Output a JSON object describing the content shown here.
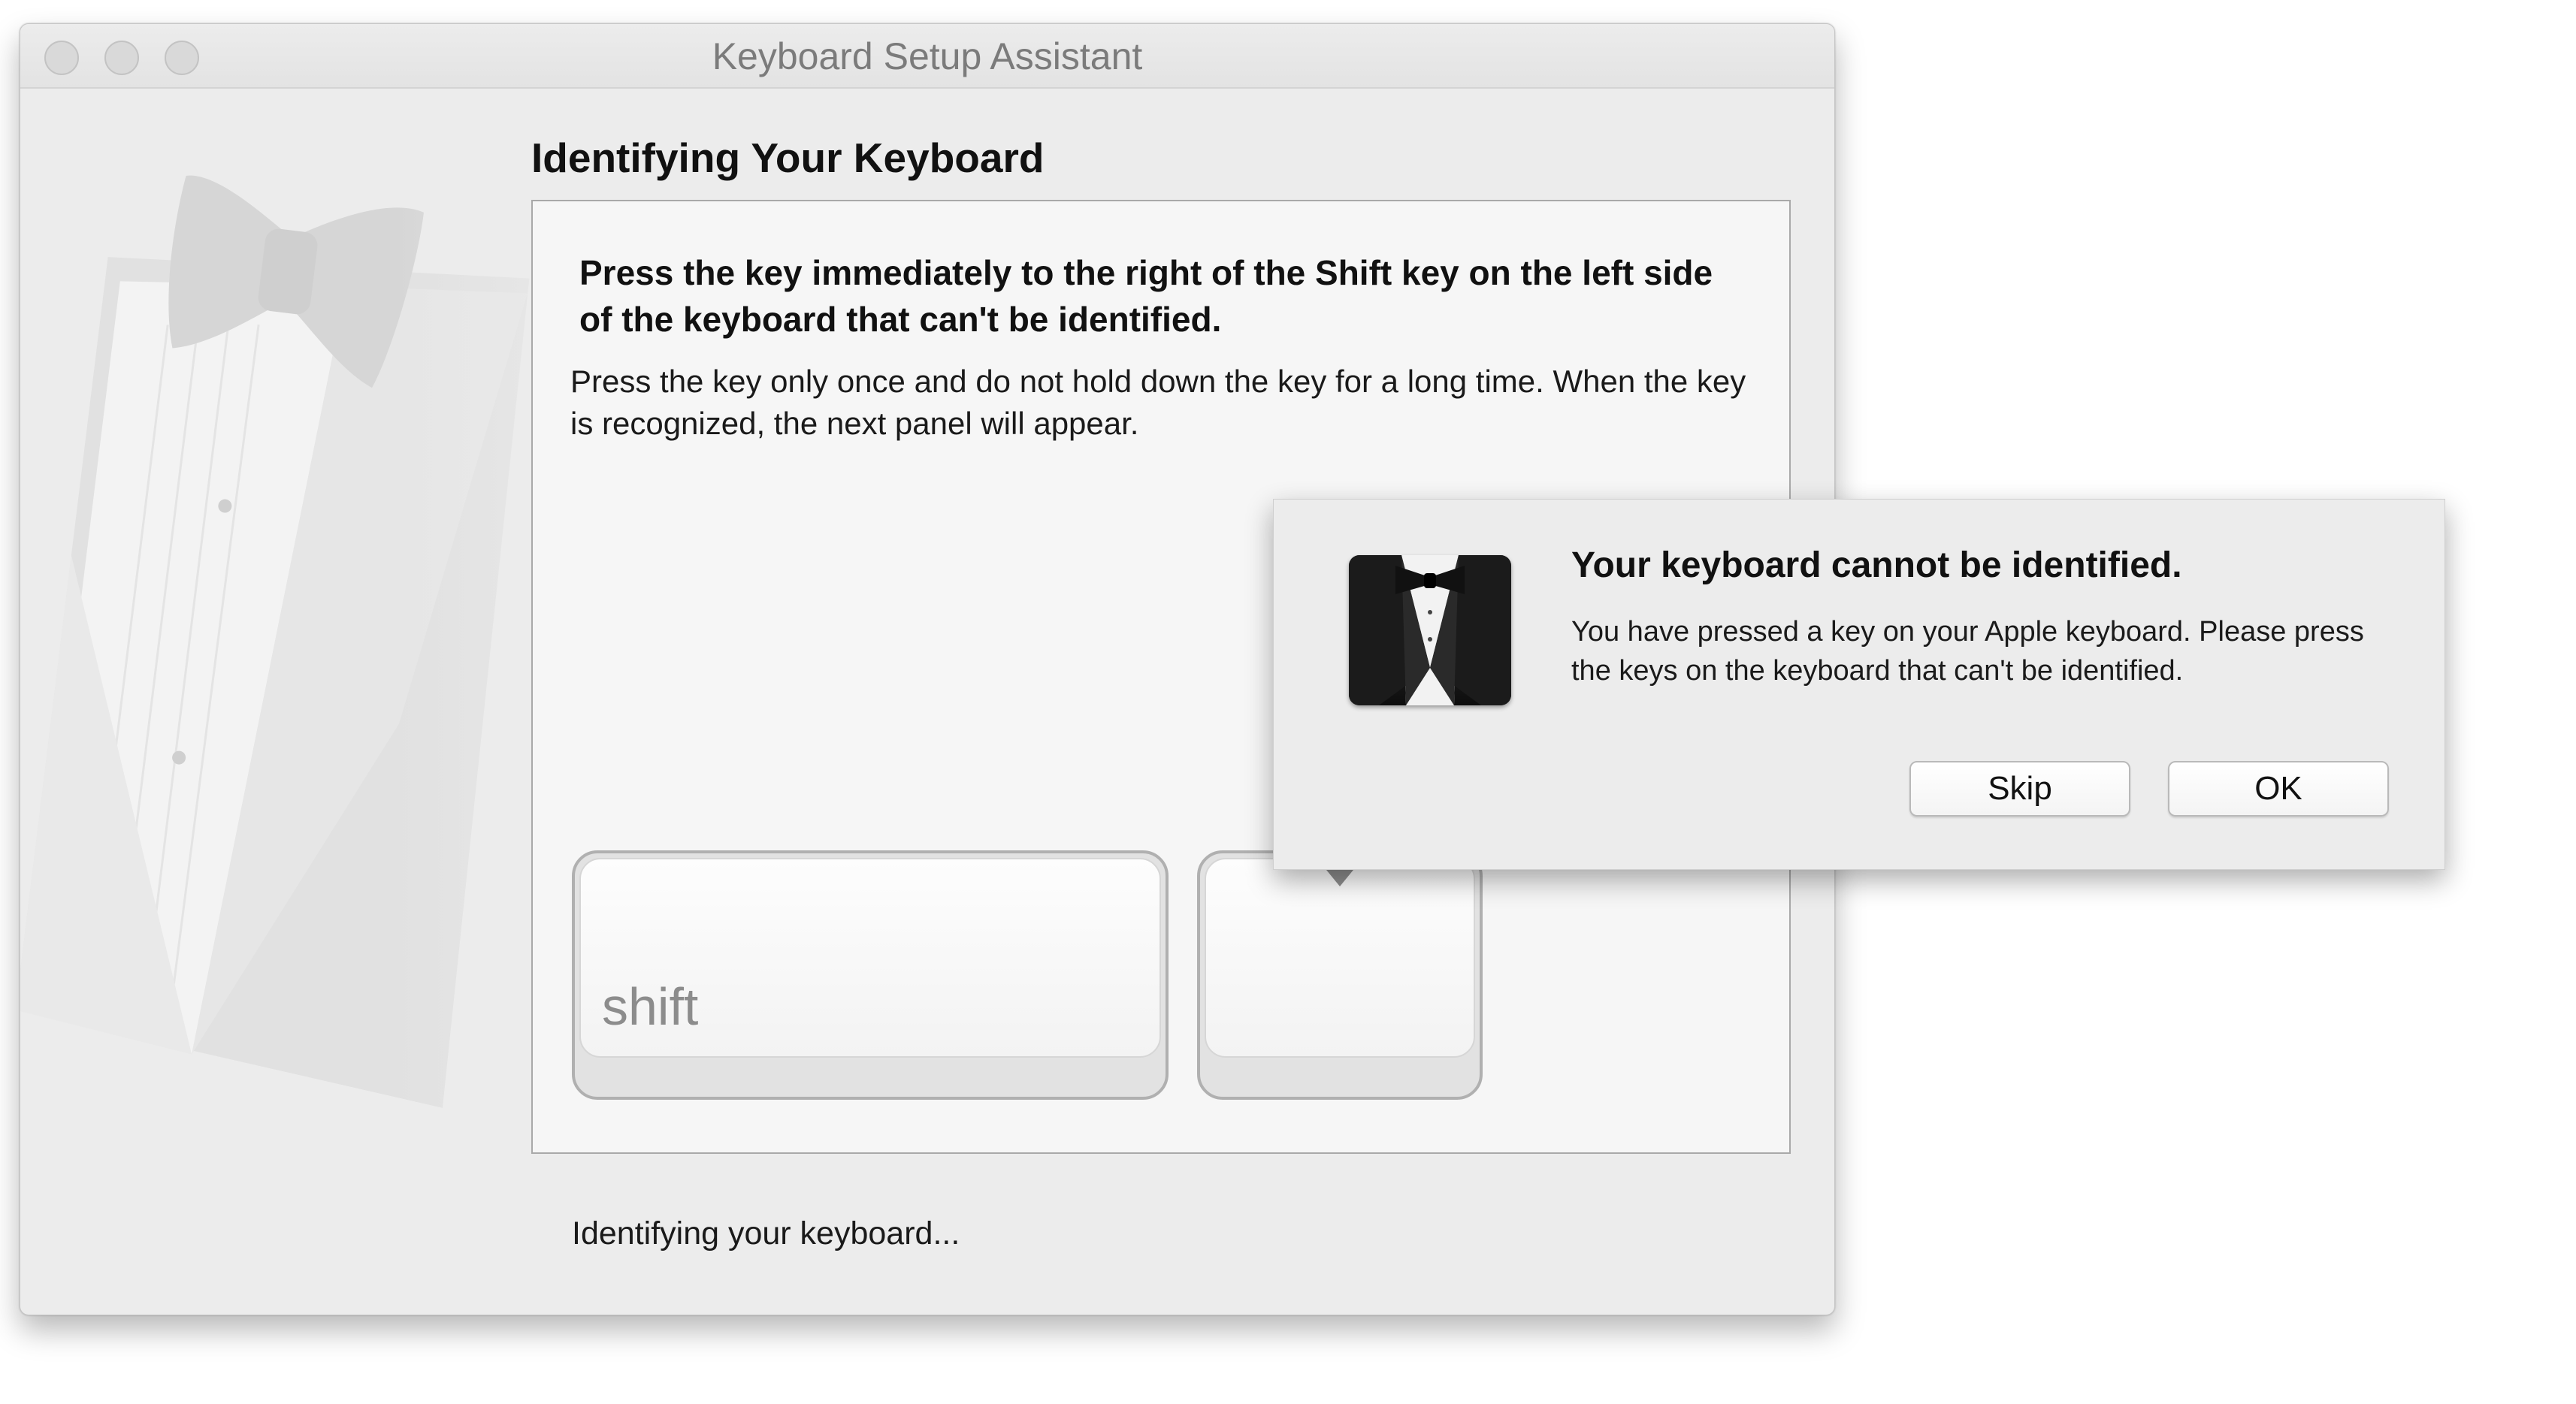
{
  "window": {
    "title": "Keyboard Setup Assistant",
    "heading": "Identifying Your Keyboard",
    "instruction_title": "Press the key immediately to the right of the Shift key on the left side of the keyboard that can't be identified.",
    "instruction_body": "Press the key only once and do not hold down the key for a long time. When the key is recognized, the next panel will appear.",
    "shift_key_label": "shift",
    "status": "Identifying your keyboard..."
  },
  "alert": {
    "title": "Your keyboard cannot be identified.",
    "message": "You have pressed a key on your Apple keyboard. Please press the keys on the keyboard that can't be identified.",
    "buttons": {
      "skip": "Skip",
      "ok": "OK"
    }
  },
  "icons": {
    "window_controls": [
      "close-icon",
      "minimize-icon",
      "zoom-icon"
    ],
    "backdrop": "tuxedo-icon",
    "alert": "keyboard-setup-tuxedo-icon"
  }
}
